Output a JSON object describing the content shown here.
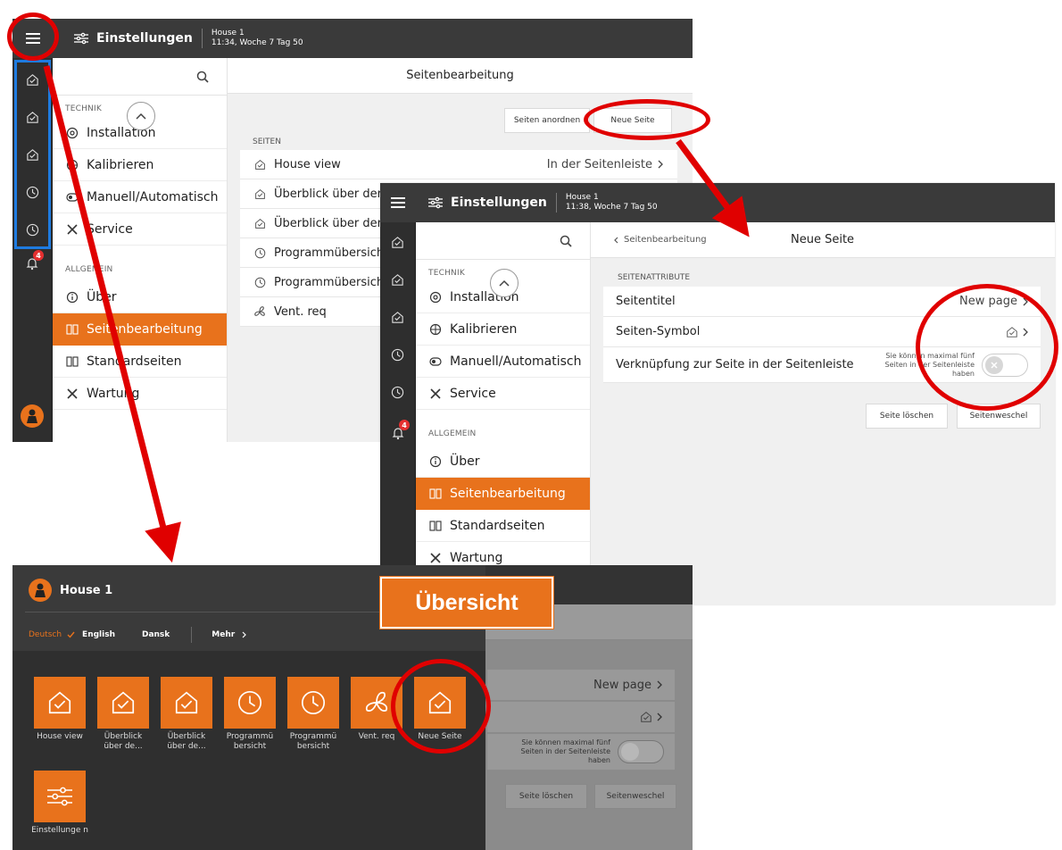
{
  "screen1": {
    "topbar": {
      "title": "Einstellungen",
      "house": "House 1",
      "time": "11:34, Woche 7 Tag 50"
    },
    "header_title": "Seitenbearbeitung",
    "menu": {
      "technik_label": "TECHNIK",
      "technik_items": [
        "Installation",
        "Kalibrieren",
        "Manuell/Automatisch",
        "Service"
      ],
      "allgemein_label": "ALLGEMEIN",
      "allgemein_items": [
        "Über",
        "Seitenbearbeitung",
        "Standardseiten",
        "Wartung"
      ]
    },
    "buttons": {
      "arrange": "Seiten anordnen",
      "new_page": "Neue Seite"
    },
    "pages_label": "SEITEN",
    "pages": [
      "House view",
      "Überblick über der",
      "Überblick über der",
      "Programmübersich",
      "Programmübersich",
      "Vent. req"
    ],
    "first_page_status": "In der Seitenleiste",
    "notification_count": "4"
  },
  "screen2": {
    "topbar": {
      "title": "Einstellungen",
      "house": "House 1",
      "time": "11:38, Woche 7 Tag 50"
    },
    "back_label": "Seitenbearbeitung",
    "header_title": "Neue Seite",
    "menu": {
      "technik_label": "TECHNIK",
      "technik_items": [
        "Installation",
        "Kalibrieren",
        "Manuell/Automatisch",
        "Service"
      ],
      "allgemein_label": "ALLGEMEIN",
      "allgemein_items": [
        "Über",
        "Seitenbearbeitung",
        "Standardseiten",
        "Wartung"
      ]
    },
    "attributes_label": "SEITENATTRIBUTE",
    "rows": {
      "title_label": "Seitentitel",
      "title_value": "New page",
      "symbol_label": "Seiten-Symbol",
      "link_label": "Verknüpfung zur Seite in der Seitenleiste",
      "link_note": "Sie können maximal fünf Seiten in der Seitenleiste haben"
    },
    "buttons": {
      "delete": "Seite löschen",
      "switch": "Seitenweschel"
    },
    "notification_count": "4"
  },
  "drawer": {
    "house": "House 1",
    "languages": [
      "Deutsch",
      "English",
      "Dansk"
    ],
    "more": "Mehr",
    "tiles": [
      "House view",
      "Überblick über de...",
      "Überblick über de...",
      "Programmü bersicht",
      "Programmü bersicht",
      "Vent. req",
      "Neue Seite"
    ],
    "settings_tile": "Einstellunge n",
    "behind": {
      "title_value": "New page",
      "link_note": "Sie können maximal fünf Seiten in der Seitenleiste haben",
      "delete": "Seite löschen",
      "switch": "Seitenweschel"
    }
  },
  "callout": "Übersicht",
  "colors": {
    "accent": "#e8721c",
    "topbar": "#3a3a3a",
    "annotation": "#e00000",
    "callout_border": "#ffffff"
  }
}
